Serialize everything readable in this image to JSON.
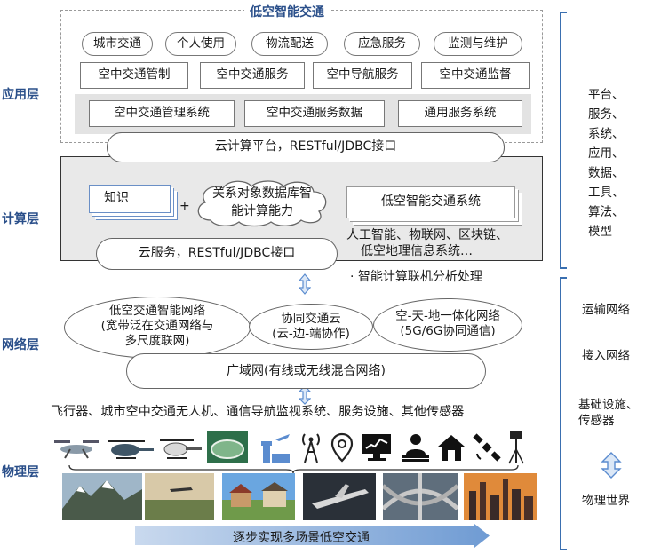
{
  "layers": {
    "application": "应用层",
    "compute": "计算层",
    "network": "网络层",
    "physical": "物理层"
  },
  "application": {
    "title": "低空智能交通",
    "scenarios": [
      "城市交通",
      "个人使用",
      "物流配送",
      "应急服务",
      "监测与维护"
    ],
    "services": [
      "空中交通管制",
      "空中交通服务",
      "空中导航服务",
      "空中交通监督"
    ],
    "systems": [
      "空中交通管理系统",
      "空中交通服务数据",
      "通用服务系统"
    ]
  },
  "compute": {
    "cloud_platform": "云计算平台，RESTful/JDBC接口",
    "knowledge": "知识",
    "plus": "+",
    "db_line1": "关系对象数据库智",
    "db_line2": "能计算能力",
    "system": "低空智能交通系统",
    "tech_line1": "人工智能、物联网、区块链、",
    "tech_line2": "低空地理信息系统…",
    "cloud_service": "云服务，RESTful/JDBC接口",
    "note": "· 智能计算联机分析处理"
  },
  "network": {
    "cloud1_l1": "低空交通智能网络",
    "cloud1_l2": "(宽带泛在交通网络与",
    "cloud1_l3": "多尺度联网)",
    "cloud2_l1": "协同交通云",
    "cloud2_l2": "(云-边-端协作)",
    "cloud3_l1": "空-天-地一体化网络",
    "cloud3_l2": "(5G/6G协同通信)",
    "wan": "广域网(有线或无线混合网络)"
  },
  "physical": {
    "devices": "飞行器、城市空中交通无人机、通信导航监视系统、服务设施、其他传感器",
    "icons": [
      "drone-icon",
      "helicopter-drone-icon",
      "helicopter-icon",
      "stadium-icon",
      "airport-icon",
      "antenna-icon",
      "location-pin-icon",
      "monitor-icon",
      "operator-icon",
      "smart-home-icon",
      "satellite-icon",
      "weather-station-icon"
    ],
    "progress": "逐步实现多场景低空交通"
  },
  "right": {
    "top_l1": "平台、",
    "top_l2": "服务、",
    "top_l3": "系统、",
    "top_l4": "应用、",
    "top_l5": "数据、",
    "top_l6": "工具、",
    "top_l7": "算法、",
    "top_l8": "模型",
    "transport_network": "运输网络",
    "access_network": "接入网络",
    "infra_l1": "基础设施、",
    "infra_l2": "传感器",
    "physical_world": "物理世界"
  },
  "colors": {
    "accent": "#2a4f8a",
    "bracket": "#3a6fb0",
    "arrow": "#5b8ccf"
  }
}
